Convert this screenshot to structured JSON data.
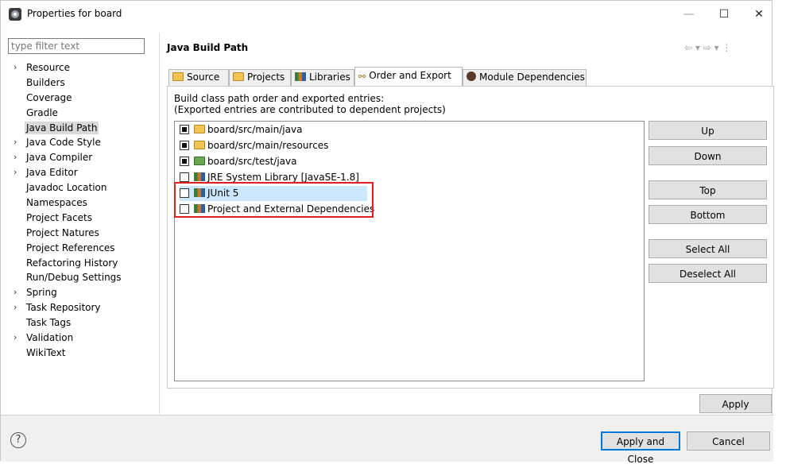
{
  "window": {
    "title": "Properties for board",
    "minimize_glyph": "—",
    "maximize_glyph": "☐",
    "close_glyph": "✕"
  },
  "sidebar": {
    "filter_placeholder": "type filter text",
    "chevron_glyph": "›",
    "items": [
      {
        "label": "Resource",
        "expandable": true
      },
      {
        "label": "Builders",
        "expandable": false
      },
      {
        "label": "Coverage",
        "expandable": false
      },
      {
        "label": "Gradle",
        "expandable": false
      },
      {
        "label": "Java Build Path",
        "expandable": false,
        "selected": true
      },
      {
        "label": "Java Code Style",
        "expandable": true
      },
      {
        "label": "Java Compiler",
        "expandable": true
      },
      {
        "label": "Java Editor",
        "expandable": true
      },
      {
        "label": "Javadoc Location",
        "expandable": false
      },
      {
        "label": "Namespaces",
        "expandable": false
      },
      {
        "label": "Project Facets",
        "expandable": false
      },
      {
        "label": "Project Natures",
        "expandable": false
      },
      {
        "label": "Project References",
        "expandable": false
      },
      {
        "label": "Refactoring History",
        "expandable": false
      },
      {
        "label": "Run/Debug Settings",
        "expandable": false
      },
      {
        "label": "Spring",
        "expandable": true
      },
      {
        "label": "Task Repository",
        "expandable": true
      },
      {
        "label": "Task Tags",
        "expandable": false
      },
      {
        "label": "Validation",
        "expandable": true
      },
      {
        "label": "WikiText",
        "expandable": false
      }
    ]
  },
  "main": {
    "title": "Java Build Path",
    "nav_arrows": "⇦ ▾ ⇨ ▾ ⋮",
    "tabs": [
      {
        "label": "Source",
        "icon": "source-folder-icon"
      },
      {
        "label": "Projects",
        "icon": "projects-folder-icon"
      },
      {
        "label": "Libraries",
        "icon": "libraries-icon"
      },
      {
        "label": "Order and Export",
        "icon": "order-export-icon",
        "active": true
      },
      {
        "label": "Module Dependencies",
        "icon": "module-icon"
      }
    ],
    "description_line1": "Build class path order and exported entries:",
    "description_line2": "(Exported entries are contributed to dependent projects)",
    "entries": [
      {
        "label": "board/src/main/java",
        "checked": true,
        "icon": "source-folder-icon"
      },
      {
        "label": "board/src/main/resources",
        "checked": true,
        "icon": "source-folder-icon"
      },
      {
        "label": "board/src/test/java",
        "checked": true,
        "icon": "test-source-folder-icon"
      },
      {
        "label": "JRE System Library [JavaSE-1.8]",
        "checked": false,
        "icon": "library-icon"
      },
      {
        "label": "JUnit 5",
        "checked": false,
        "icon": "library-icon",
        "highlighted": true
      },
      {
        "label": "Project and External Dependencies",
        "checked": false,
        "icon": "library-icon"
      }
    ],
    "buttons": {
      "up": "Up",
      "down": "Down",
      "top": "Top",
      "bottom": "Bottom",
      "select_all": "Select All",
      "deselect_all": "Deselect All"
    },
    "apply": "Apply"
  },
  "footer": {
    "help_glyph": "?",
    "apply_and_close": "Apply and Close",
    "cancel": "Cancel"
  },
  "colors": {
    "highlight_row": "#cce8ff",
    "annotation_box": "#e02020",
    "default_button_border": "#0078d7"
  }
}
